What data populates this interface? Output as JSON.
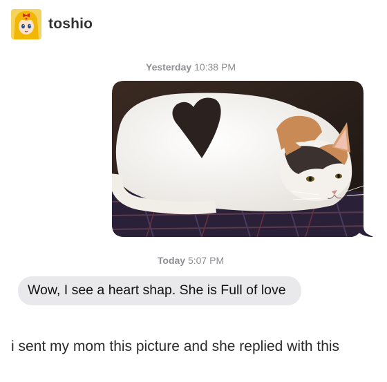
{
  "header": {
    "username": "toshio",
    "avatar_icon": "sailor-venus-avatar-icon"
  },
  "conversation": {
    "timestamp_1": {
      "day": "Yesterday",
      "time": "10:38 PM"
    },
    "sent_image": {
      "description_icon": "calico-cat-photo"
    },
    "timestamp_2": {
      "day": "Today",
      "time": "5:07 PM"
    },
    "received_message": "Wow, I see a heart shap. She is Full of love"
  },
  "caption": "i sent my mom this picture and she replied with this",
  "colors": {
    "received_bubble": "#e9e9eb",
    "timestamp": "#8e8e93",
    "text": "#111111"
  }
}
